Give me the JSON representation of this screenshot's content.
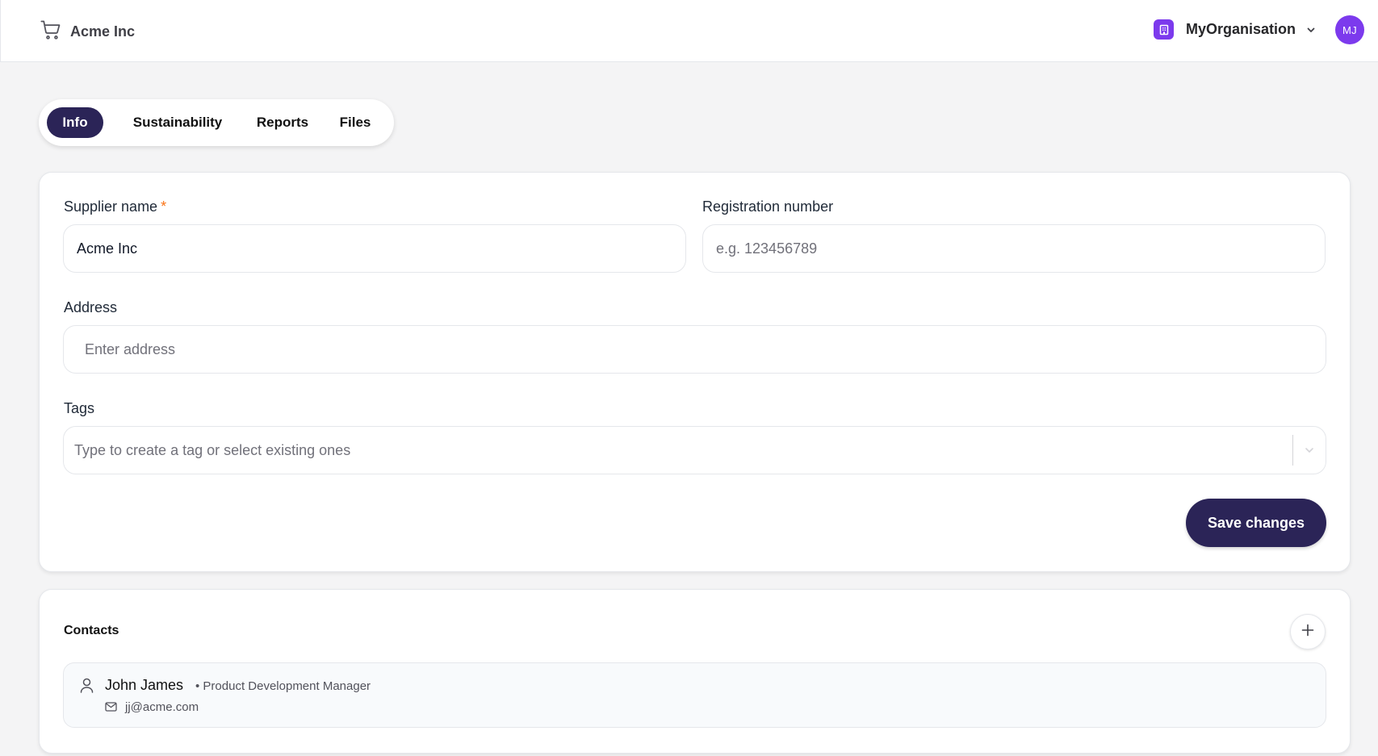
{
  "header": {
    "company_name": "Acme Inc",
    "org_name": "MyOrganisation",
    "avatar_initials": "MJ",
    "icons": {
      "brand": "cart-icon",
      "org": "building-icon",
      "org_menu": "chevron-down-icon"
    }
  },
  "tabs": [
    {
      "label": "Info",
      "active": true
    },
    {
      "label": "Sustainability",
      "active": false
    },
    {
      "label": "Reports",
      "active": false
    },
    {
      "label": "Files",
      "active": false
    }
  ],
  "form": {
    "supplier_name": {
      "label": "Supplier name",
      "required_marker": "*",
      "value": "Acme Inc"
    },
    "registration_number": {
      "label": "Registration number",
      "value": "",
      "placeholder": "e.g. 123456789"
    },
    "address": {
      "label": "Address",
      "value": "",
      "placeholder": "Enter address"
    },
    "tags": {
      "label": "Tags",
      "placeholder": "Type to create a tag or select existing ones"
    },
    "save_label": "Save changes"
  },
  "contacts": {
    "title": "Contacts",
    "items": [
      {
        "name": "John James",
        "role": "• Product Development Manager",
        "email": "jj@acme.com"
      }
    ]
  },
  "colors": {
    "primary": "#2b2457",
    "accent": "#7c3aed",
    "required": "#f97316",
    "background": "#f4f4f5"
  }
}
